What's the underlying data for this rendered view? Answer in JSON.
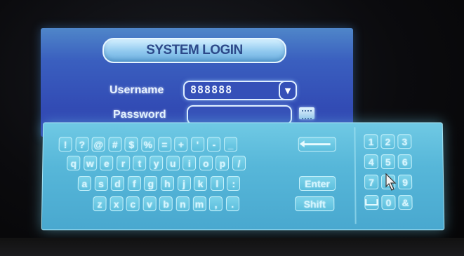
{
  "login": {
    "title": "SYSTEM LOGIN",
    "username_label": "Username",
    "username_value": "888888",
    "password_label": "Password",
    "password_value": ""
  },
  "keyboard": {
    "row1": [
      "!",
      "?",
      "@",
      "#",
      "$",
      "%",
      "=",
      "+",
      "'",
      "-",
      "_"
    ],
    "row2": [
      "q",
      "w",
      "e",
      "r",
      "t",
      "y",
      "u",
      "i",
      "o",
      "p",
      "/"
    ],
    "row3": [
      "a",
      "s",
      "d",
      "f",
      "g",
      "h",
      "j",
      "k",
      "l",
      ":"
    ],
    "row4": [
      "z",
      "x",
      "c",
      "v",
      "b",
      "n",
      "m",
      ",",
      "."
    ],
    "enter_label": "Enter",
    "shift_label": "Shift",
    "numpad": [
      "1",
      "2",
      "3",
      "4",
      "5",
      "6",
      "7",
      "8",
      "9",
      "0",
      "&"
    ]
  },
  "icons": {
    "dropdown": "chevron-down-icon",
    "keyboard": "keyboard-icon",
    "backspace": "backspace-icon",
    "space": "space-icon",
    "cursor": "mouse-pointer-icon"
  }
}
